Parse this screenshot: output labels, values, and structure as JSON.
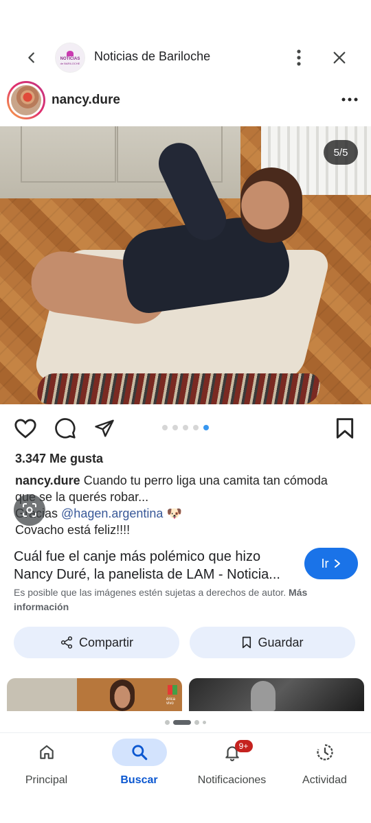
{
  "topbar": {
    "site_logo_line1": "NOTICIAS",
    "site_logo_line2": "de BARILOCHE",
    "title": "Noticias de Bariloche"
  },
  "post": {
    "username": "nancy.dure",
    "counter": "5/5",
    "dots_total": 5,
    "dots_active": 5,
    "likes": "3.347 Me gusta",
    "caption_user": "nancy.dure",
    "caption_line1": "Cuando tu perro liga una camita tan cómoda",
    "caption_line2": "que se la querés robar...",
    "caption_thanks_prefix": "Gracias ",
    "caption_mention": "@hagen.argentina",
    "caption_emoji": "🐶",
    "caption_line4": "Covacho está feliz!!!!"
  },
  "result": {
    "title_line1": "Cuál fue el canje más polémico que hizo",
    "title_line2": "Nancy Duré, la panelista de LAM - Noticia...",
    "go_label": "Ir",
    "copyright_text": "Es posible que las imágenes estén sujetas a derechos de autor.",
    "more_info": "Más información",
    "share_label": "Compartir",
    "save_label": "Guardar"
  },
  "related": {
    "thumb1_badge": "érica vivo"
  },
  "bottom_nav": {
    "items": [
      {
        "label": "Principal",
        "icon": "home-icon"
      },
      {
        "label": "Buscar",
        "icon": "search-icon",
        "active": true
      },
      {
        "label": "Notificaciones",
        "icon": "bell-icon",
        "badge": "9+"
      },
      {
        "label": "Actividad",
        "icon": "history-icon"
      }
    ]
  },
  "colors": {
    "accent": "#1a73e8",
    "pill_bg": "#e8effc",
    "nav_active": "#d3e3fd",
    "badge": "#c5221f",
    "ig_dot_active": "#3897f0"
  }
}
